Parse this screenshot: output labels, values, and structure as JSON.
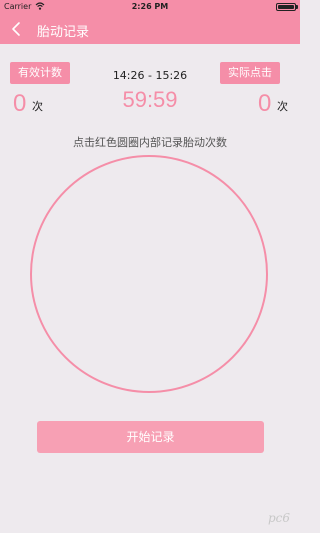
{
  "status_bar": {
    "carrier": "Carrier",
    "time": "2:26 PM",
    "wifi_icon": "wifi-icon",
    "battery_icon": "battery-icon"
  },
  "nav": {
    "back_icon": "chevron-left-icon",
    "title": "胎动记录"
  },
  "effective_count": {
    "label": "有效计数",
    "value": "0",
    "unit": "次"
  },
  "actual_clicks": {
    "label": "实际点击",
    "value": "0",
    "unit": "次"
  },
  "session": {
    "time_range": "14:26 - 15:26",
    "countdown": "59:59"
  },
  "hint": "点击红色圆圈内部记录胎动次数",
  "start_button_label": "开始记录",
  "watermark": "pc6",
  "colors": {
    "accent": "#f58ea8",
    "background": "#eeeaee",
    "button": "#f7a0b4"
  }
}
